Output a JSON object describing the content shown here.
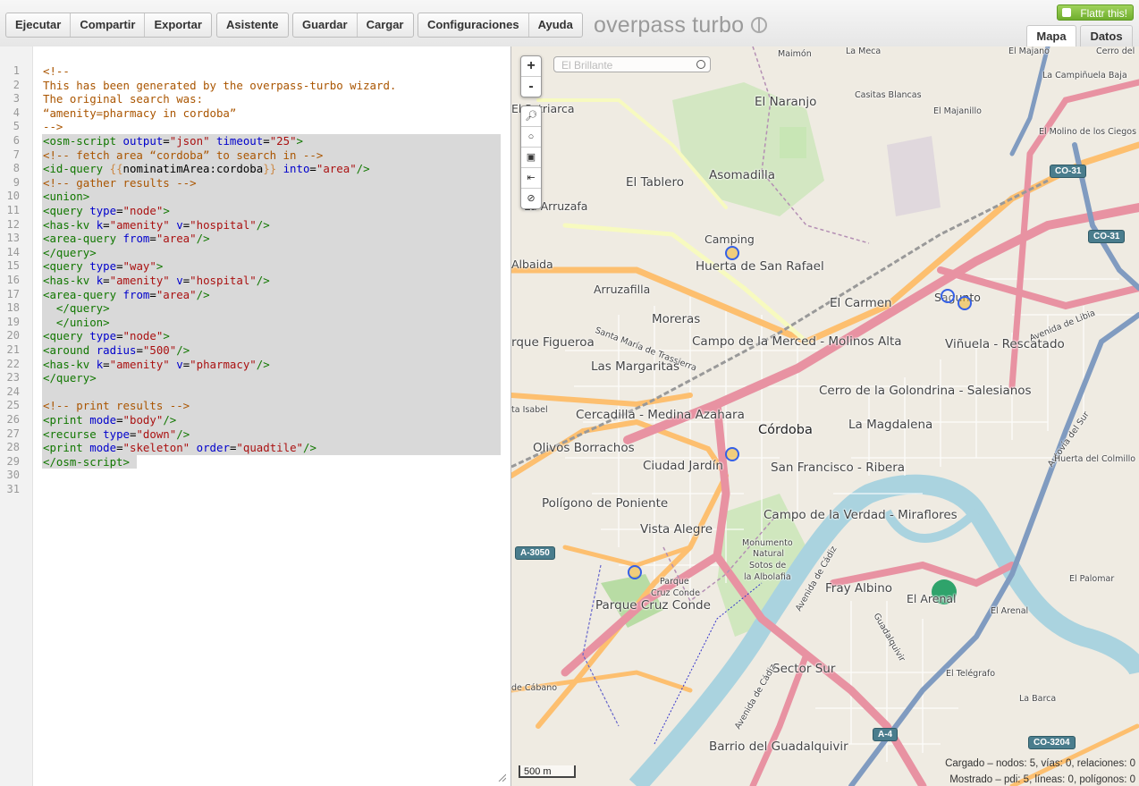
{
  "toolbar": {
    "run": "Ejecutar",
    "share": "Compartir",
    "export": "Exportar",
    "wizard": "Asistente",
    "save": "Guardar",
    "load": "Cargar",
    "settings": "Configuraciones",
    "help": "Ayuda"
  },
  "logo": "overpass turbo",
  "flattr": "Flattr this!",
  "tabs": {
    "map": "Mapa",
    "data": "Datos"
  },
  "editor": {
    "line_numbers": [
      "1",
      "2",
      "3",
      "4",
      "5",
      "6",
      "7",
      "8",
      "9",
      "10",
      "11",
      "12",
      "13",
      "14",
      "15",
      "16",
      "17",
      "18",
      "19",
      "20",
      "21",
      "22",
      "23",
      "24",
      "25",
      "26",
      "27",
      "28",
      "29",
      "30",
      "31"
    ]
  },
  "map": {
    "zoom_in": "+",
    "zoom_out": "-",
    "search_placeholder": "El Brillante",
    "scale": "500 m",
    "status_loaded": "Cargado – nodos: 5, vías: 0, relaciones: 0",
    "status_shown": "Mostrado – pdi: 5, líneas: 0, polígonos: 0",
    "labels": {
      "maimon": "Maimón",
      "la_meca": "La Meca",
      "el_majano": "El Majano",
      "cerro": "Cerro del",
      "campinuela": "La Campiñuela Baja",
      "el_brillante": "El Brillante",
      "patriarca": "El Patriarca",
      "el_naranjo": "El Naranjo",
      "casitas": "Casitas Blancas",
      "majanillo": "El Majanillo",
      "molino": "El Molino de los Ciegos",
      "asomadilla": "Asomadilla",
      "el_tablero": "El Tablero",
      "arruzafa": "La Arruzafa",
      "camping": "Camping",
      "huerta": "Huerta de San Rafael",
      "albaida": "Albaida",
      "arruzafilla": "Arruzafilla",
      "el_carmen": "El Carmen",
      "sagunto": "Sagunto",
      "moreras": "Moreras",
      "santa_maria": "Santa María de Trassierra",
      "figueroa": "rque Figueroa",
      "campo_merced": "Campo de la Merced - Molinos Alta",
      "vinuela": "Viñuela - Rescatado",
      "libia": "Avenida de Libia",
      "margaritas": "Las Margaritas",
      "golondrina": "Cerro de la Golondrina - Salesianos",
      "isabel": "ta Isabel",
      "cercadilla": "Cercadilla - Medina Azahara",
      "cordoba": "Córdoba",
      "magdalena": "La Magdalena",
      "olivos": "Olivos Borrachos",
      "ciudad_jardin": "Ciudad Jardín",
      "san_francisco": "San Francisco - Ribera",
      "autovia": "Autovía del Sur",
      "colmillo": "Huerta del Colmillo",
      "poniente": "Polígono de Poniente",
      "verdad": "Campo de la Verdad - Miraflores",
      "vista_alegre": "Vista Alegre",
      "monumento": "Monumento",
      "natural": "Natural",
      "sotos": "Sotos de",
      "albolafia": "la Albolafia",
      "parque1": "Parque",
      "parque2": "Cruz Conde",
      "parque_cruz": "Parque Cruz Conde",
      "fray": "Fray Albino",
      "el_arenal": "El Arenal",
      "arenal2": "El Arenal",
      "palomar": "El Palomar",
      "guadalquivir": "Guadalquivir",
      "cadiz": "Avenida de Cádiz",
      "sector_sur": "Sector Sur",
      "telegrafo": "El Telégrafo",
      "barca": "La Barca",
      "cabano": "de Cábano",
      "barrio": "Barrio del Guadalquivir",
      "cadiz2": "Avenida de Cádiz"
    },
    "shields": {
      "co31a": "CO-31",
      "co31b": "CO-31",
      "a3050": "A-3050",
      "a4": "A-4",
      "co3204": "CO-3204"
    }
  }
}
